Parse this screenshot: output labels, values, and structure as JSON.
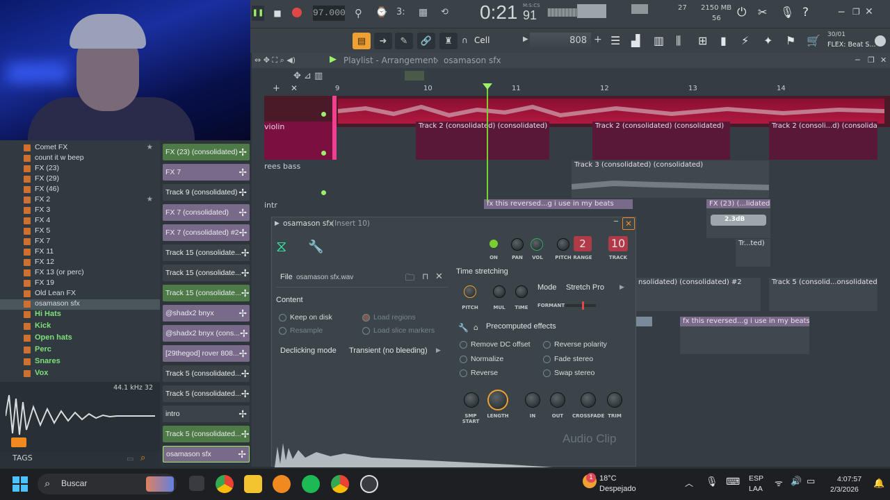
{
  "transport": {
    "tempo": "97.000",
    "time": "0:21",
    "time_small": "91",
    "time_label": "M:S:CS",
    "cpu_num": "27",
    "memory": "2150 MB",
    "polyphony": "56"
  },
  "toolbar": {
    "snap": "Cell",
    "pattern": "808",
    "hint_counter": "30/01",
    "hint_text": "FLEX: Beat S..."
  },
  "playlist": {
    "title": "Playlist - Arrangement",
    "current": "osamason sfx",
    "ruler": [
      "9",
      "10",
      "11",
      "12",
      "13",
      "14"
    ]
  },
  "tracks": [
    {
      "name": "violin"
    },
    {
      "name": "rees bass"
    },
    {
      "name": "intr"
    }
  ],
  "clips": {
    "c1": "Track 2 (consolidated) (consolidated)",
    "c2": "Track 2 (consolidated) (consolidated)",
    "c3": "Track 2 (consoli...d) (consolidated)",
    "c4": "Track 3 (consolidated) (consolidated)",
    "c5": "fx this reversed...g i use in my beats",
    "c6": "FX (23) (...lidated)",
    "c6_db": "2.3dB",
    "c7": "Tr...ted)",
    "c8": "nsolidated) (consolidated) #2",
    "c9": "Track 5 (consolid...onsolidated) #2",
    "c10": "fx this reversed...g i use in my beats"
  },
  "browser": {
    "items": [
      {
        "label": "Comet FX",
        "type": "file"
      },
      {
        "label": "count it w beep",
        "type": "file"
      },
      {
        "label": "FX (23)",
        "type": "file"
      },
      {
        "label": "FX (29)",
        "type": "file"
      },
      {
        "label": "FX (46)",
        "type": "file"
      },
      {
        "label": "FX 2",
        "type": "file"
      },
      {
        "label": "FX 3",
        "type": "file"
      },
      {
        "label": "FX 4",
        "type": "file"
      },
      {
        "label": "FX 5",
        "type": "file"
      },
      {
        "label": "FX 7",
        "type": "file"
      },
      {
        "label": "FX 11",
        "type": "file"
      },
      {
        "label": "FX 12",
        "type": "file"
      },
      {
        "label": "FX 13 (or perc)",
        "type": "file"
      },
      {
        "label": "FX 19",
        "type": "file"
      },
      {
        "label": "Old Lean FX",
        "type": "file"
      },
      {
        "label": "osamason sfx",
        "type": "file"
      },
      {
        "label": "Hi Hats",
        "type": "folder"
      },
      {
        "label": "Kick",
        "type": "folder"
      },
      {
        "label": "Open hats",
        "type": "folder"
      },
      {
        "label": "Perc",
        "type": "folder"
      },
      {
        "label": "Snares",
        "type": "folder"
      },
      {
        "label": "Vox",
        "type": "folder"
      }
    ],
    "sample_info": "44.1 kHz 32",
    "tags_label": "TAGS"
  },
  "channels": [
    {
      "label": "FX (23) (consolidated)",
      "style": "green"
    },
    {
      "label": "FX 7",
      "style": "purple"
    },
    {
      "label": "Track 9 (consolidated)",
      "style": "dark"
    },
    {
      "label": "FX 7 (consolidated)",
      "style": "purple"
    },
    {
      "label": "FX 7 (consolidated) #2",
      "style": "purple"
    },
    {
      "label": "Track 15 (consolidate...",
      "style": "dark"
    },
    {
      "label": "Track 15 (consolidate...",
      "style": "dark"
    },
    {
      "label": "Track 15 (consolidate...",
      "style": "green"
    },
    {
      "label": "@shadx2 bnyx",
      "style": "purple"
    },
    {
      "label": "@shadx2 bnyx (cons...",
      "style": "purple"
    },
    {
      "label": "[29thegod] rover 808...",
      "style": "purple"
    },
    {
      "label": "Track 5 (consolidated...",
      "style": "dark"
    },
    {
      "label": "Track 5 (consolidated...",
      "style": "dark"
    },
    {
      "label": "intro",
      "style": "dark"
    },
    {
      "label": "Track 5 (consolidated...",
      "style": "green"
    },
    {
      "label": "osamason sfx",
      "style": "purple"
    }
  ],
  "plugin": {
    "title": "osamason sfx",
    "insert": "(Insert 10)",
    "pitch_range": "2",
    "track": "10",
    "knob_labels": {
      "on": "ON",
      "pan": "PAN",
      "vol": "VOL",
      "pitch": "PITCH",
      "range": "RANGE",
      "track": "TRACK"
    },
    "file_label": "File",
    "file_name": "osamason sfx.wav",
    "content_label": "Content",
    "keep_on_disk": "Keep on disk",
    "resample": "Resample",
    "load_regions": "Load regions",
    "load_slice": "Load slice markers",
    "declicking_label": "Declicking mode",
    "declicking_value": "Transient (no bleeding)",
    "ts_label": "Time stretching",
    "ts_knobs": {
      "pitch": "PITCH",
      "mul": "MUL",
      "time": "TIME"
    },
    "mode_label": "Mode",
    "mode_value": "Stretch Pro",
    "formant": "FORMANT",
    "precomputed": "Precomputed effects",
    "effects": [
      "Remove DC offset",
      "Reverse polarity",
      "Normalize",
      "Fade stereo",
      "Reverse",
      "Swap stereo"
    ],
    "bottom_knobs": {
      "smp_start": "SMP START",
      "length": "LENGTH",
      "in": "IN",
      "out": "OUT",
      "crossfade": "CROSSFADE",
      "trim": "TRIM"
    },
    "watermark": "Audio Clip"
  },
  "taskbar": {
    "search": "Buscar",
    "weather_temp": "18°C",
    "weather_desc": "Despejado",
    "weather_badge": "1",
    "lang1": "ESP",
    "lang2": "LAA",
    "time": "4:07:57",
    "date": "2/3/2026"
  },
  "colors": {
    "accent": "#9cf06a",
    "violin": "#c02050",
    "playhead": "#7ad030"
  }
}
